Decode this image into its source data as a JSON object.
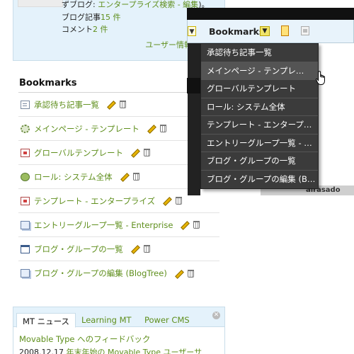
{
  "user_stats": {
    "blog_desc_prefix": "ずブログ: ",
    "blog_desc_link": "エンタープライズ検索 - 編集",
    "blog_desc_suffix": ")。",
    "entries_label": "ブログ記事",
    "entries_count": "15 件",
    "comments_label": "コメント",
    "comments_count": "2 件",
    "user_info_link": "ユーザー情報"
  },
  "bookmarks": {
    "title": "Bookmarks",
    "items": [
      {
        "label": "承認待ち記事一覧",
        "icon": "document-icon"
      },
      {
        "label": "メインページ - テンプレート",
        "icon": "gear-icon"
      },
      {
        "label": "グローバルテンプレート",
        "icon": "template-icon"
      },
      {
        "label": "ロール: システム全体",
        "icon": "users-icon"
      },
      {
        "label": "テンプレート - エンタープライズ",
        "icon": "template-icon"
      },
      {
        "label": "エントリーグループ一覧 - Enterprise",
        "icon": "pages-icon"
      },
      {
        "label": "ブログ・グループの一覧",
        "icon": "window-icon"
      },
      {
        "label": "ブログ・グループの編集 (BlogTree)",
        "icon": "pages-icon"
      }
    ]
  },
  "dropdown": {
    "title": "Bookmarks",
    "items": [
      "承認待ち記事一覧",
      "メインページ - テンプレ…",
      "グローバルテンプレート",
      "ロール: システム全体",
      "テンプレート - エンタープ…",
      "エントリーグループ一覧 - …",
      "ブログ・グループの一覧",
      "ブログ・グループの編集 (B…"
    ],
    "hover_index": 1
  },
  "news": {
    "tabs": [
      "MT ニュース",
      "Learning MT",
      "Power CMS"
    ],
    "active_tab": 0,
    "feedback_link": "Movable Type へのフィードバック",
    "entry_date": "2008.12.17",
    "entry_link": "年末年始の Movable Type ユーザーサ"
  },
  "background": {
    "caption": "airasado"
  }
}
